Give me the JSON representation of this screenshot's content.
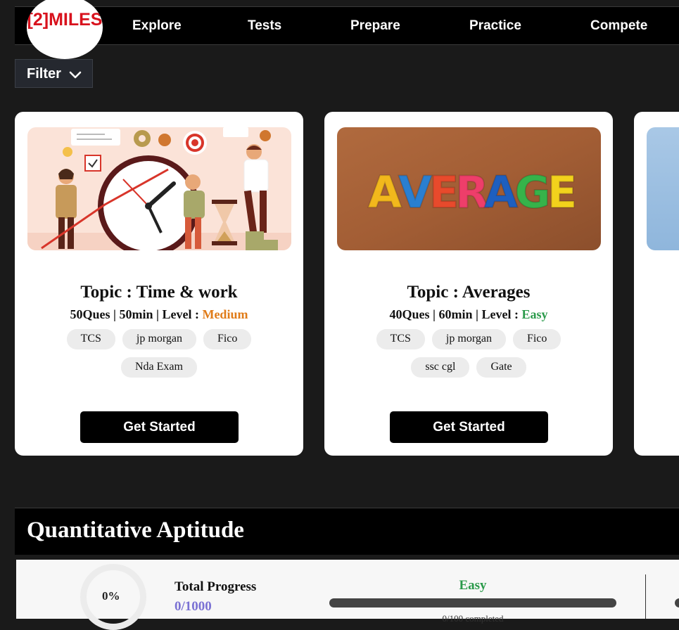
{
  "navbar": {
    "logo": "[2]MILES",
    "items": [
      "Explore",
      "Tests",
      "Prepare",
      "Practice",
      "Compete"
    ]
  },
  "filter": {
    "label": "Filter"
  },
  "cards": [
    {
      "title": "Topic : Time & work",
      "meta": "50Ques | 50min | Level : ",
      "level": "Medium",
      "tags": [
        "TCS",
        "jp morgan",
        "Fico",
        "Nda Exam"
      ],
      "button": "Get Started"
    },
    {
      "title": "Topic : Averages",
      "meta": "40Ques | 60min | Level : ",
      "level": "Easy",
      "image_text": "AVERAGE",
      "tags": [
        "TCS",
        "jp morgan",
        "Fico",
        "ssc cgl",
        "Gate"
      ],
      "button": "Get Started"
    }
  ],
  "section": {
    "title": "Quantitative Aptitude",
    "progress_percent": "0%",
    "total_progress_label": "Total Progress",
    "total_progress_value": "0/1000",
    "easy_label": "Easy",
    "easy_fraction": 0,
    "easy_sub": "0/100 completed"
  },
  "colors": {
    "medium": "#e07b18",
    "easy": "#2a9a4a",
    "progress": "#7b72d4",
    "logo": "#d8121d"
  }
}
